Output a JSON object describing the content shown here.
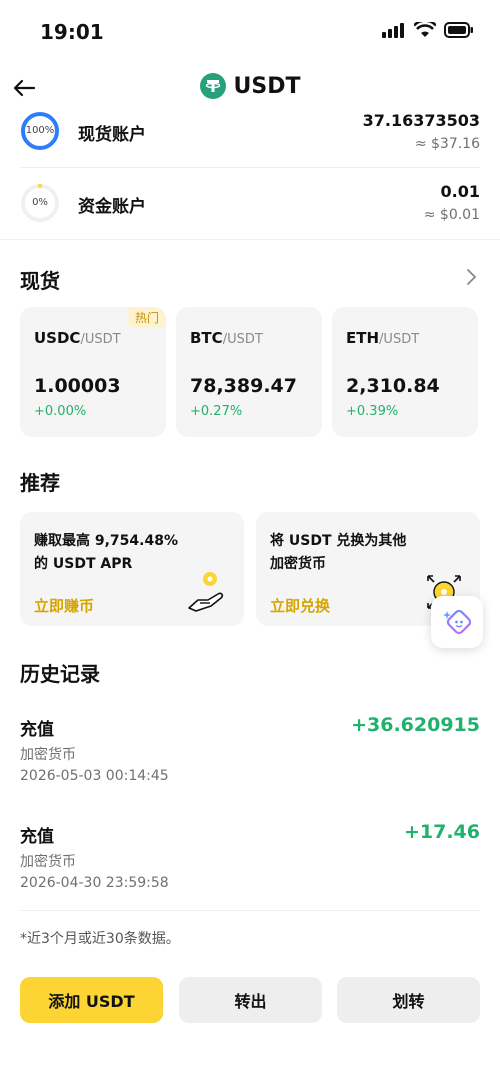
{
  "status_bar": {
    "time": "19:01"
  },
  "header": {
    "title": "USDT"
  },
  "accounts": [
    {
      "name": "现货账户",
      "percent": "100%",
      "amount": "37.16373503",
      "fiat": "≈ $37.16",
      "fill": 1.0
    },
    {
      "name": "资金账户",
      "percent": "0%",
      "amount": "0.01",
      "fiat": "≈ $0.01",
      "fill": 0.0
    }
  ],
  "spot": {
    "title": "现货",
    "cards": [
      {
        "base": "USDC",
        "quote": "/USDT",
        "price": "1.00003",
        "change": "+0.00%",
        "badge": "热门"
      },
      {
        "base": "BTC",
        "quote": "/USDT",
        "price": "78,389.47",
        "change": "+0.27%"
      },
      {
        "base": "ETH",
        "quote": "/USDT",
        "price": "2,310.84",
        "change": "+0.39%"
      }
    ]
  },
  "recommend": {
    "title": "推荐",
    "cards": [
      {
        "text": "赚取最高 9,754.48% 的 USDT APR",
        "link": "立即赚币",
        "icon": "coin-hand-icon"
      },
      {
        "text": "将 USDT 兑换为其他加密货币",
        "link": "立即兑换",
        "icon": "coin-convert-icon"
      }
    ]
  },
  "history": {
    "title": "历史记录",
    "items": [
      {
        "type": "充值",
        "amount": "+36.620915",
        "sub": "加密货币",
        "date": "2026-05-03 00:14:45"
      },
      {
        "type": "充值",
        "amount": "+17.46",
        "sub": "加密货币",
        "date": "2026-04-30 23:59:58"
      }
    ],
    "footnote": "*近3个月或近30条数据。"
  },
  "actions": {
    "add": "添加 USDT",
    "withdraw": "转出",
    "transfer": "划转"
  },
  "colors": {
    "accent": "#fcd535",
    "positive": "#20b26c",
    "ring": "#2d7ff9",
    "link": "#d8a400"
  }
}
